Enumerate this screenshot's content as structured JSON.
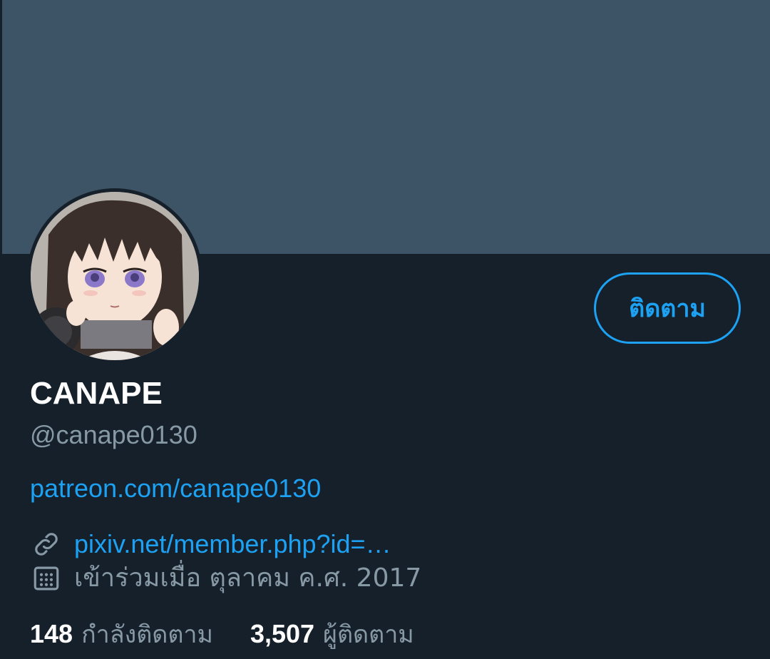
{
  "profile": {
    "follow_label": "ติดตาม",
    "display_name": "CANAPE",
    "handle": "@canape0130",
    "bio_link": "patreon.com/canape0130",
    "website": "pixiv.net/member.php?id=…",
    "joined": "เข้าร่วมเมื่อ ตุลาคม ค.ศ. 2017"
  },
  "stats": {
    "following_count": "148",
    "following_label": "กำลังติดตาม",
    "followers_count": "3,507",
    "followers_label": "ผู้ติดตาม"
  },
  "icons": {
    "link": "link-icon",
    "calendar": "calendar-icon"
  },
  "colors": {
    "background": "#15202b",
    "banner": "#3d5466",
    "accent": "#1da1f2",
    "secondary_text": "#8899a6"
  }
}
